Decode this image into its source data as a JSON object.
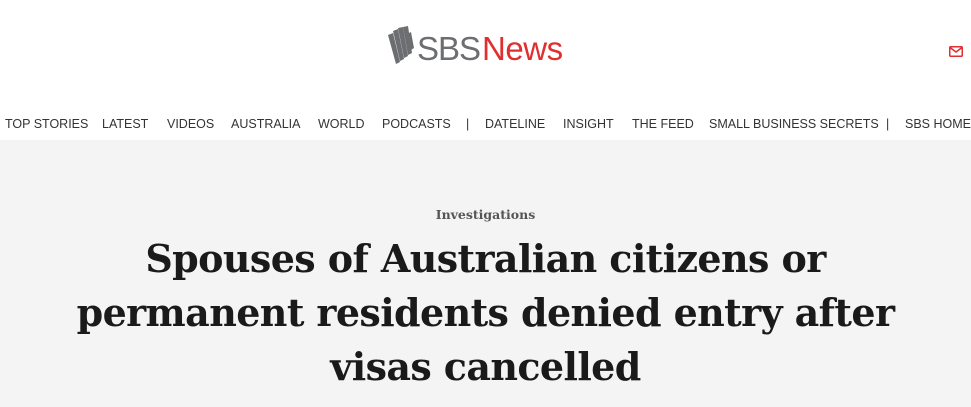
{
  "header": {
    "logo": {
      "sbs_text": "SBS",
      "news_text": "News",
      "sbs_color": "#6d6e71",
      "news_color": "#e02f2f"
    },
    "mail_icon": "mail-icon"
  },
  "nav": {
    "items": [
      {
        "label": "TOP STORIES"
      },
      {
        "label": "LATEST"
      },
      {
        "label": "VIDEOS"
      },
      {
        "label": "AUSTRALIA"
      },
      {
        "label": "WORLD"
      },
      {
        "label": "PODCASTS"
      },
      {
        "label": "DATELINE"
      },
      {
        "label": "INSIGHT"
      },
      {
        "label": "THE FEED"
      },
      {
        "label": "SMALL BUSINESS SECRETS"
      },
      {
        "label": "SBS HOME"
      }
    ],
    "separator": "|"
  },
  "article": {
    "category": "Investigations",
    "headline": "Spouses of Australian citizens or permanent residents denied entry after visas cancelled"
  },
  "colors": {
    "hero_background": "#f4f4f4",
    "headline_text": "#1a1a1a",
    "accent_red": "#e02f2f"
  }
}
